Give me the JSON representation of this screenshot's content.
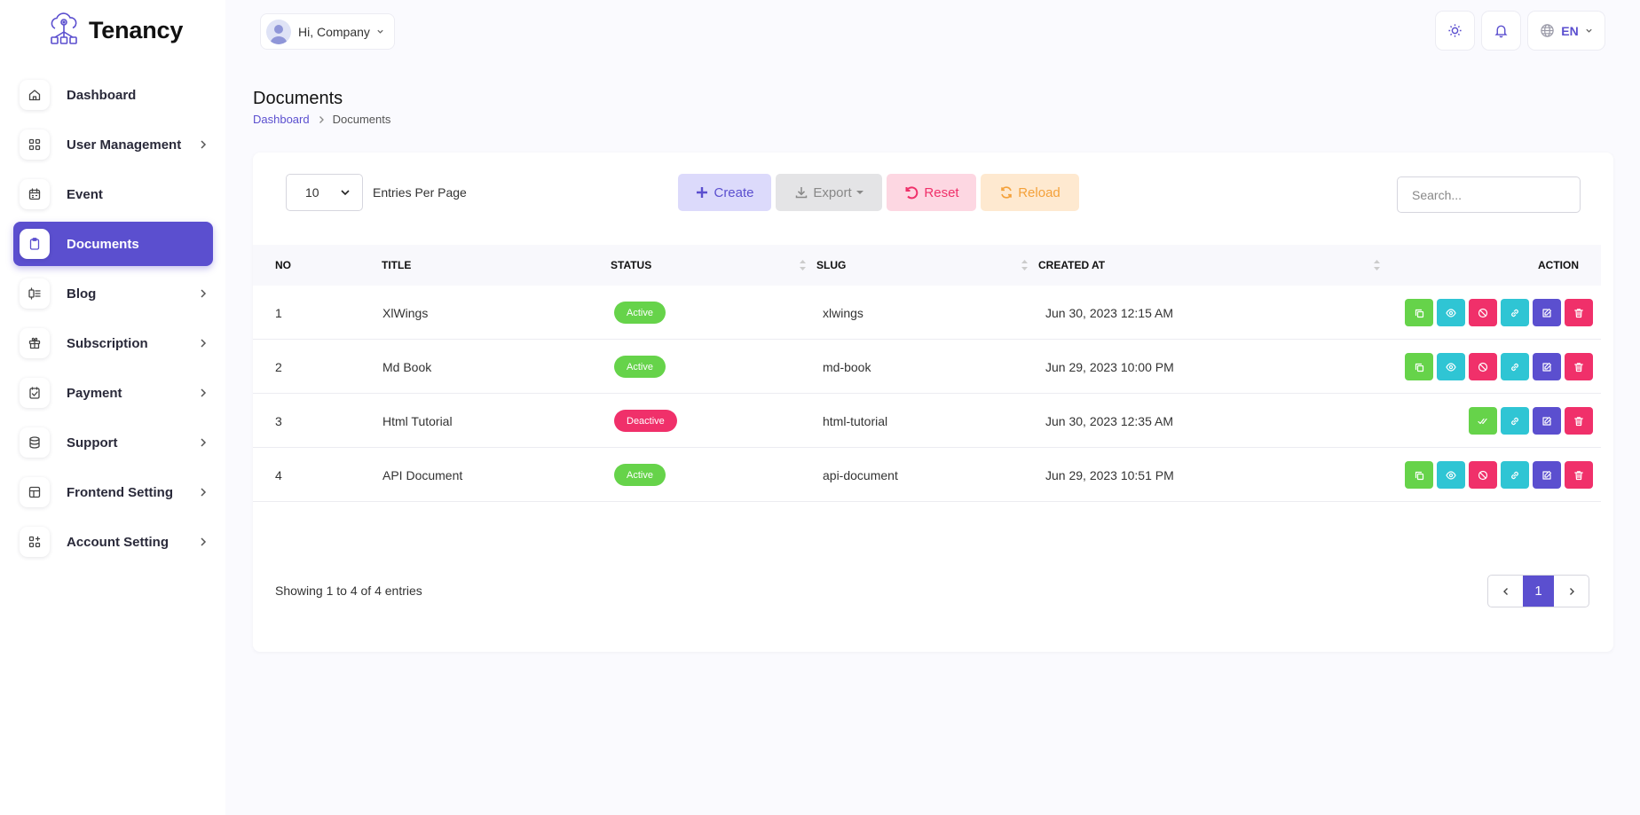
{
  "brand": {
    "name": "Tenancy"
  },
  "colors": {
    "primary": "#5b4fcf",
    "green": "#66d34a",
    "cyan": "#2fc5d4",
    "pink": "#f0306a",
    "orange": "#f4a13a"
  },
  "topbar": {
    "greeting": "Hi, Company",
    "language": "EN"
  },
  "sidebar": {
    "items": [
      {
        "label": "Dashboard",
        "icon": "home-icon",
        "chevron": false
      },
      {
        "label": "User Management",
        "icon": "grid-icon",
        "chevron": true
      },
      {
        "label": "Event",
        "icon": "calendar-icon",
        "chevron": false
      },
      {
        "label": "Documents",
        "icon": "clipboard-icon",
        "chevron": false,
        "active": true
      },
      {
        "label": "Blog",
        "icon": "blog-icon",
        "chevron": true
      },
      {
        "label": "Subscription",
        "icon": "gift-icon",
        "chevron": true
      },
      {
        "label": "Payment",
        "icon": "payment-icon",
        "chevron": true
      },
      {
        "label": "Support",
        "icon": "database-icon",
        "chevron": true
      },
      {
        "label": "Frontend Setting",
        "icon": "layout-icon",
        "chevron": true
      },
      {
        "label": "Account Setting",
        "icon": "settings-grid-icon",
        "chevron": true
      }
    ]
  },
  "header": {
    "title": "Documents",
    "breadcrumb": {
      "home": "Dashboard",
      "current": "Documents"
    }
  },
  "toolbar": {
    "entries_value": "10",
    "entries_label": "Entries Per Page",
    "create": "Create",
    "export": "Export",
    "reset": "Reset",
    "reload": "Reload",
    "search_placeholder": "Search..."
  },
  "table": {
    "columns": {
      "no": "NO",
      "title": "TITLE",
      "status": "STATUS",
      "slug": "SLUG",
      "created_at": "CREATED AT",
      "action": "ACTION"
    },
    "rows": [
      {
        "no": "1",
        "title": "XlWings",
        "status": "Active",
        "slug": "xlwings",
        "created_at": "Jun 30, 2023 12:15 AM",
        "actions": [
          "copy",
          "view",
          "disable",
          "link",
          "edit",
          "delete"
        ]
      },
      {
        "no": "2",
        "title": "Md Book",
        "status": "Active",
        "slug": "md-book",
        "created_at": "Jun 29, 2023 10:00 PM",
        "actions": [
          "copy",
          "view",
          "disable",
          "link",
          "edit",
          "delete"
        ]
      },
      {
        "no": "3",
        "title": "Html Tutorial",
        "status": "Deactive",
        "slug": "html-tutorial",
        "created_at": "Jun 30, 2023 12:35 AM",
        "actions": [
          "activate",
          "link",
          "edit",
          "delete"
        ]
      },
      {
        "no": "4",
        "title": "API Document",
        "status": "Active",
        "slug": "api-document",
        "created_at": "Jun 29, 2023 10:51 PM",
        "actions": [
          "copy",
          "view",
          "disable",
          "link",
          "edit",
          "delete"
        ]
      }
    ]
  },
  "footer": {
    "showing": "Showing 1 to 4 of 4 entries",
    "current_page": "1"
  }
}
